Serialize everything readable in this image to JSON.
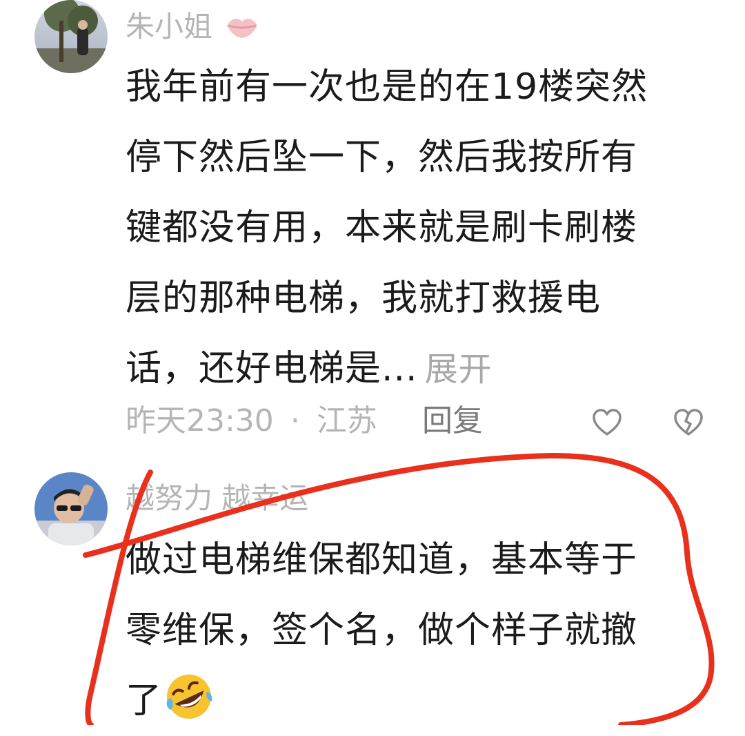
{
  "comments": [
    {
      "username": "朱小姐",
      "username_badge_icon": "lips-icon",
      "lines": [
        "我年前有一次也是的在19楼突然",
        "停下然后坠一下，然后我按所有",
        "键都没有用，本来就是刷卡刷楼",
        "层的那种电梯，我就打救援电",
        "话，还好电梯是..."
      ],
      "expand_label": "展开",
      "time": "昨天23:30",
      "separator": "·",
      "location": "江苏",
      "reply_label": "回复",
      "like_icon": "heart-outline-icon",
      "dislike_icon": "broken-heart-icon"
    },
    {
      "username": "越努力 越幸运",
      "lines": [
        "做过电梯维保都知道，基本等于",
        "零维保，签个名，做个样子就撤",
        "了"
      ],
      "trailing_emoji": "rolling-on-floor-laughing-emoji"
    }
  ],
  "colors": {
    "annotation_stroke": "#e8301c",
    "meta_text": "#b5b5b5",
    "body_text": "#1b1b1b"
  }
}
